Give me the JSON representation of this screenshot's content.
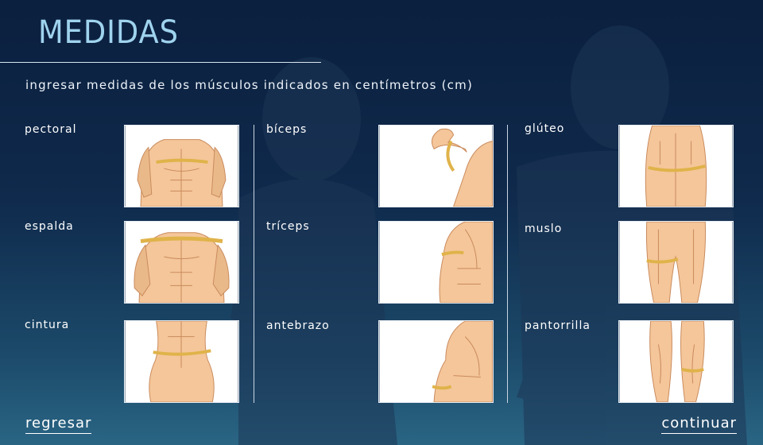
{
  "page": {
    "title": "MEDIDAS",
    "subtitle": "ingresar medidas de los músculos indicados en centímetros (cm)"
  },
  "muscles": [
    {
      "label": "pectoral",
      "image": "chest-tape-illustration"
    },
    {
      "label": "espalda",
      "image": "back-tape-illustration"
    },
    {
      "label": "cintura",
      "image": "waist-tape-illustration"
    },
    {
      "label": "bíceps",
      "image": "biceps-tape-illustration"
    },
    {
      "label": "tríceps",
      "image": "triceps-tape-illustration"
    },
    {
      "label": "antebrazo",
      "image": "forearm-tape-illustration"
    },
    {
      "label": "glúteo",
      "image": "glute-tape-illustration"
    },
    {
      "label": "muslo",
      "image": "thigh-tape-illustration"
    },
    {
      "label": "pantorrilla",
      "image": "calf-tape-illustration"
    }
  ],
  "navigation": {
    "back_label": "regresar",
    "continue_label": "continuar"
  },
  "colors": {
    "title": "#9fd3ee",
    "skin": "#f4c69a",
    "tape": "#e0b34a",
    "background_top": "#0b1f3e",
    "background_bottom": "#2a6584"
  }
}
